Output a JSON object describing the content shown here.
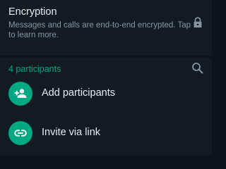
{
  "encryption": {
    "title": "Encryption",
    "description": "Messages and calls are end-to-end encrypted. Tap to learn more.",
    "icon": "lock-icon"
  },
  "participants": {
    "header": "4 participants",
    "search_icon": "search-icon",
    "actions": [
      {
        "label": "Add participants",
        "icon": "add-person-icon"
      },
      {
        "label": "Invite via link",
        "icon": "link-icon"
      }
    ]
  },
  "colors": {
    "background": "#0b1419",
    "card": "#121b22",
    "accent": "#00a884",
    "primary_text": "#e9edef",
    "secondary_text": "#8696a0"
  }
}
